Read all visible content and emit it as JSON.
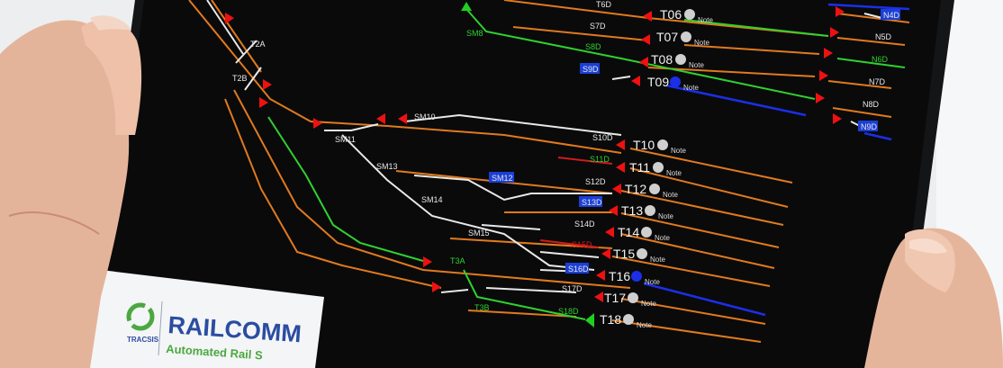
{
  "colors": {
    "screen_bg": "#0a0a0b",
    "orange_track": "#e07a1e",
    "white_track": "#e8e8e8",
    "green_route": "#2fd12f",
    "blue_route": "#1b2fe8",
    "red_track": "#d11b1b",
    "signal_red": "#ee1111",
    "signal_green": "#1fd11f",
    "label_blue_bg": "#1b3fd6",
    "brand_green": "#4aa83f",
    "brand_blue": "#2b4da1"
  },
  "branding": {
    "company": "TRACSIS",
    "product": "RAILCOMM",
    "tagline": "Automated Rail S"
  },
  "trains": [
    {
      "id": "T06",
      "note": "Note",
      "state": "grey"
    },
    {
      "id": "T07",
      "note": "Note",
      "state": "grey"
    },
    {
      "id": "T08",
      "note": "Note",
      "state": "grey"
    },
    {
      "id": "T09",
      "note": "Note",
      "state": "blue"
    },
    {
      "id": "T10",
      "note": "Note",
      "state": "grey"
    },
    {
      "id": "T11",
      "note": "Note",
      "state": "grey"
    },
    {
      "id": "T12",
      "note": "Note",
      "state": "grey"
    },
    {
      "id": "T13",
      "note": "Note",
      "state": "grey"
    },
    {
      "id": "T14",
      "note": "Note",
      "state": "grey"
    },
    {
      "id": "T15",
      "note": "Note",
      "state": "grey"
    },
    {
      "id": "T16",
      "note": "Note",
      "state": "blue"
    },
    {
      "id": "T17",
      "note": "Note",
      "state": "grey"
    },
    {
      "id": "T18",
      "note": "Note",
      "state": "grey"
    }
  ],
  "track_labels": {
    "t6d": "T6D",
    "s7d": "S7D",
    "s8d": "S8D",
    "s9d": "S9D",
    "n4d": "N4D",
    "n5d": "N5D",
    "n6d": "N6D",
    "n7d": "N7D",
    "n8d": "N8D",
    "n9d": "N9D",
    "sm8": "SM8",
    "sm10": "SM10",
    "sm11": "SM11",
    "sm12": "SM12",
    "sm13": "SM13",
    "sm14": "SM14",
    "sm15": "SM15",
    "s10d": "S10D",
    "s11d": "S11D",
    "s12d": "S12D",
    "s13d": "S13D",
    "s14d": "S14D",
    "s15d": "S15D",
    "s16d": "S16D",
    "s17d": "S17D",
    "s18d": "S18D",
    "t2a": "T2A",
    "t2b": "T2B",
    "t3a": "T3A",
    "t3b": "T3B"
  }
}
